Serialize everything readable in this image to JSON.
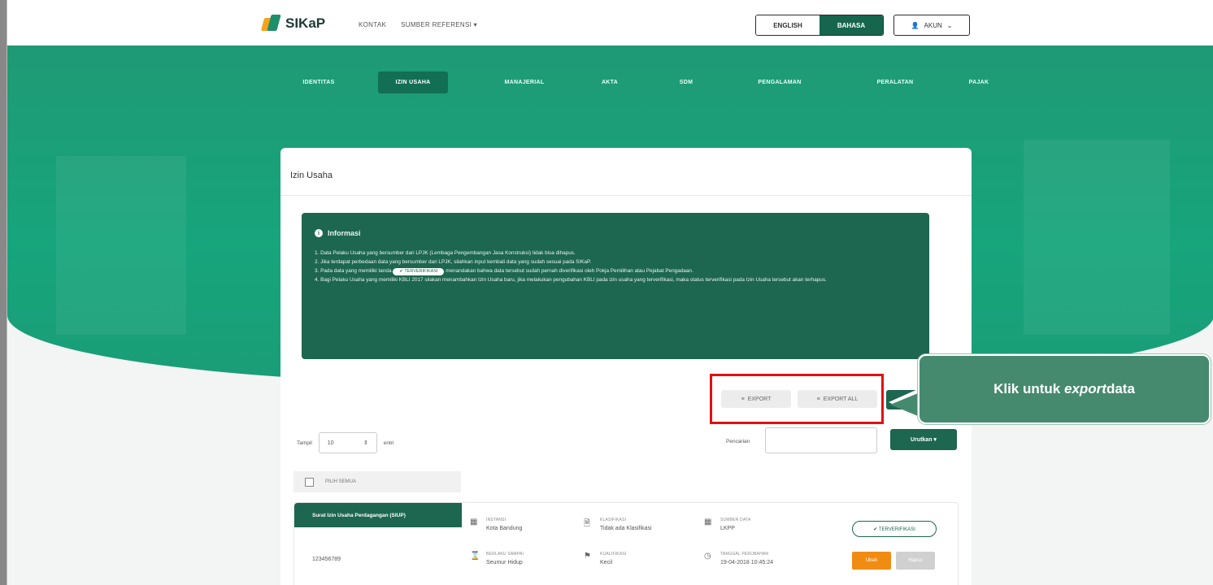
{
  "app": {
    "name": "SIKaP"
  },
  "topnav": [
    "KONTAK",
    "SUMBER REFERENSI ▾"
  ],
  "lang": {
    "english": "ENGLISH",
    "bahasa": "BAHASA"
  },
  "akun": {
    "label": "AKUN",
    "icon": "user-icon"
  },
  "tabs": [
    "IDENTITAS",
    "IZIN USAHA",
    "MANAJERIAL",
    "AKTA",
    "SDM",
    "PENGALAMAN",
    "PERALATAN",
    "PAJAK"
  ],
  "active_tab": "IZIN USAHA",
  "card": {
    "title": "Izin Usaha"
  },
  "info": {
    "heading": "Informasi",
    "line1": "1. Data Pelaku Usaha yang bersumber dari LPJK (Lembaga Pengembangan Jasa Konstruksi) tidak bisa dihapus.",
    "line2": "2. Jika terdapat perbedaan data yang bersumber dari LPJK, silahkan input kembali data yang sudah sesuai pada SIKaP.",
    "line3a": "3. Pada data yang memiliki tanda",
    "pill": "✔ TERVERIFIKASI",
    "line3b": "menandakan bahwa data tersebut sudah pernah diverifikasi oleh Pokja Pemilihan atau Pejabat Pengadaan.",
    "line4": "4. Bagi Pelaku Usaha yang memiliki KBLI 2017 silakan menambahkan Izin Usaha baru, jika melakukan pengubahan KBLI pada izin usaha yang terverifikasi, maka status terverifikasi pada Izin Usaha tersebut akan terhapus."
  },
  "export": {
    "export": "EXPORT",
    "export_all": "EXPORT ALL"
  },
  "list": {
    "tampil_label": "Tampil",
    "tampil_value": "10",
    "entri_label": "entri",
    "search_label": "Pencarian",
    "search_value": "",
    "sort_label": "Urutkan ▾",
    "select_all": "PILIH SEMUA"
  },
  "item": {
    "type": "Surat Izin Usaha Perdagangan (SIUP)",
    "number": "123456789",
    "instansi_label": "INSTANSI",
    "instansi": "Kota Bandung",
    "klasifikasi_label": "KLASIFIKASI",
    "klasifikasi": "Tidak ada Klasifikasi",
    "sumber_label": "SUMBER DATA",
    "sumber": "LKPP",
    "berlaku_label": "BERLAKU SAMPAI",
    "berlaku": "Seumur Hidup",
    "kualifikasi_label": "KUALIFIKASI",
    "kualifikasi": "Kecil",
    "tanggal_label": "TANGGAL PERUBAHAN",
    "tanggal": "19-04-2018 10:45:24",
    "verified": "✔ TERVERIFIKASI",
    "ubah": "Ubah",
    "hapus": "Hapus"
  },
  "callout": {
    "text_plain": "Klik untuk ",
    "text_em": "export",
    "text_end": " data"
  },
  "colors": {
    "primary": "#1d6650",
    "accent": "#17a57c",
    "highlight": "#e01111",
    "callout": "#458a6f",
    "edit": "#f08c12"
  }
}
